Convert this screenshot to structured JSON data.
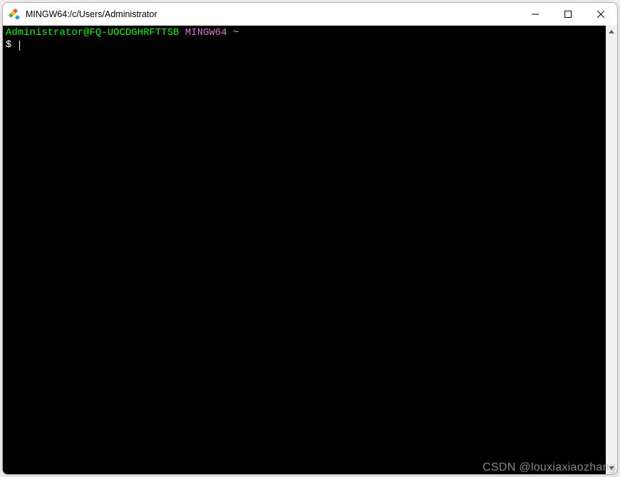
{
  "window": {
    "title": "MINGW64:/c/Users/Administrator"
  },
  "terminal": {
    "prompt_user": "Administrator@FQ-UOCDGHRFTTSB",
    "prompt_env": "MINGW64",
    "prompt_path": "~",
    "prompt_symbol": "$"
  },
  "watermark": "CSDN @louxiaxiaozhang"
}
